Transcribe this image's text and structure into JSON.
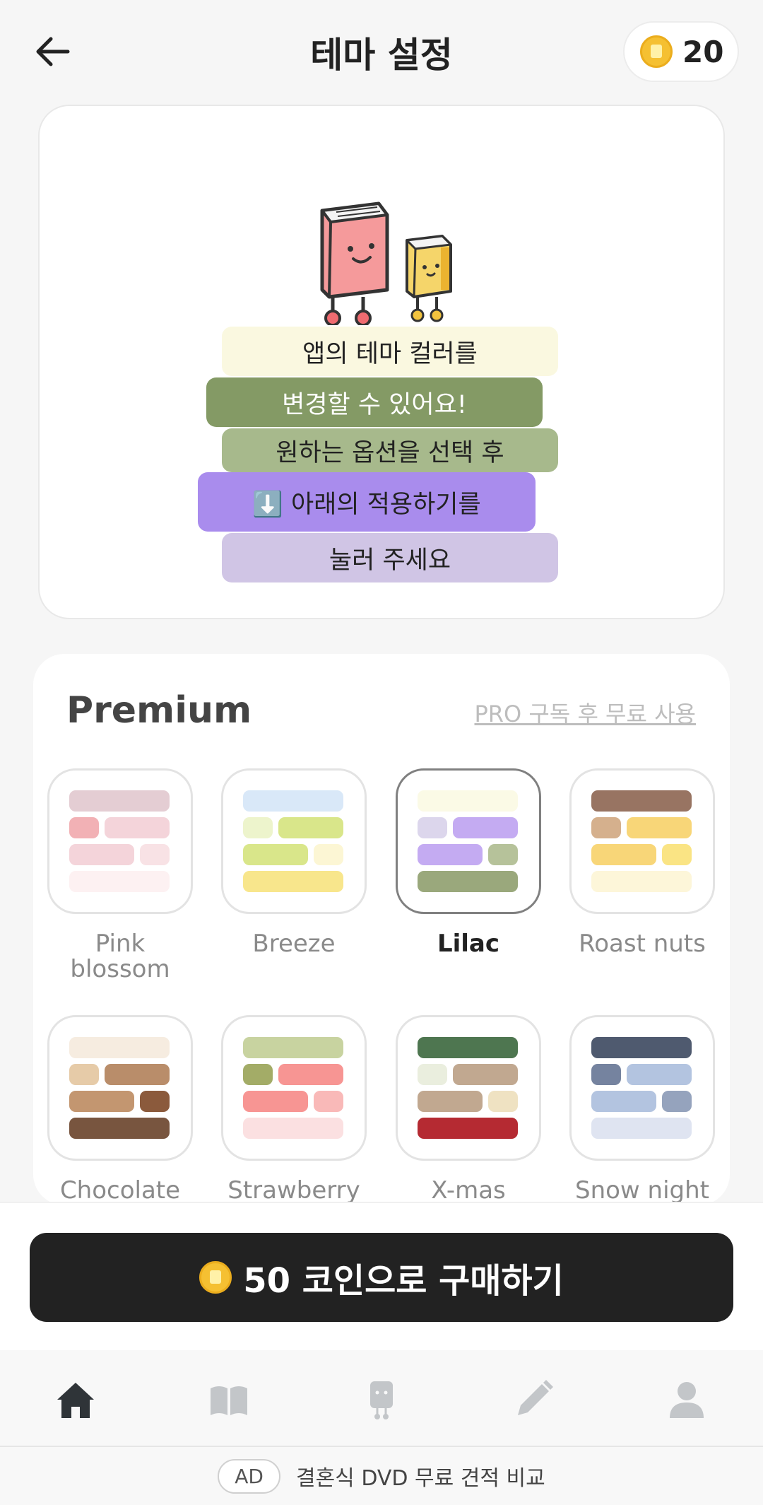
{
  "header": {
    "title": "테마 설정",
    "coin_count": "20",
    "back_icon": "arrow-left-icon",
    "coin_icon": "coin-icon"
  },
  "intro": {
    "lines": [
      {
        "text": "앱의 테마 컬러를",
        "bg": "#faf8e0"
      },
      {
        "text": "변경할 수 있어요!",
        "bg": "#849a65"
      },
      {
        "text": "원하는 옵션을 선택 후",
        "bg": "#a7b98c"
      },
      {
        "text": "⬇️ 아래의 적용하기를",
        "bg": "#a98ced"
      },
      {
        "text": "눌러 주세요",
        "bg": "#d0c5e5"
      }
    ]
  },
  "premium": {
    "title": "Premium",
    "pro_link": "PRO 구독 후 무료 사용",
    "themes": [
      {
        "name": "Pink blossom",
        "selected": false,
        "colors": [
          "#e4cdd3",
          "#f2b1b5",
          "#f4d4da",
          "#f4d4da",
          "#f8e2e5",
          "#fdf1f2"
        ]
      },
      {
        "name": "Breeze",
        "selected": false,
        "colors": [
          "#d9e8f8",
          "#edf4cc",
          "#d9e68a",
          "#d9e68a",
          "#fcf6d4",
          "#f8e68c"
        ]
      },
      {
        "name": "Lilac",
        "selected": true,
        "colors": [
          "#fbfae6",
          "#dcd6ec",
          "#c4abf2",
          "#c4abf2",
          "#b6c29a",
          "#9aa87c"
        ]
      },
      {
        "name": "Roast nuts",
        "selected": false,
        "colors": [
          "#987462",
          "#d5b08d",
          "#f8d678",
          "#f8d678",
          "#fae484",
          "#fdf6d9"
        ]
      },
      {
        "name": "Chocolate",
        "selected": false,
        "colors": [
          "#f6ece0",
          "#e6cba8",
          "#b98d6a",
          "#c39670",
          "#8b5a3c",
          "#78553f"
        ]
      },
      {
        "name": "Strawberry",
        "selected": false,
        "colors": [
          "#c8d3a0",
          "#a3ac67",
          "#f79593",
          "#f79593",
          "#f9b9b8",
          "#fbe0e1"
        ]
      },
      {
        "name": "X-mas",
        "selected": false,
        "colors": [
          "#4e7650",
          "#eaeede",
          "#c1a890",
          "#c1a890",
          "#efe2c2",
          "#b52a32"
        ]
      },
      {
        "name": "Snow night",
        "selected": false,
        "colors": [
          "#4f5a6f",
          "#75839f",
          "#b3c4e0",
          "#b3c4e0",
          "#95a3bd",
          "#dfe4f1"
        ]
      }
    ]
  },
  "purchase": {
    "label": "50 코인으로 구매하기",
    "coin_icon": "coin-icon"
  },
  "nav": {
    "items": [
      {
        "name": "home",
        "icon": "home-icon",
        "active": true
      },
      {
        "name": "library",
        "icon": "book-icon",
        "active": false
      },
      {
        "name": "character",
        "icon": "character-icon",
        "active": false
      },
      {
        "name": "write",
        "icon": "pencil-icon",
        "active": false
      },
      {
        "name": "profile",
        "icon": "person-icon",
        "active": false
      }
    ]
  },
  "ad": {
    "badge": "AD",
    "text": "결혼식 DVD 무료 견적 비교"
  }
}
